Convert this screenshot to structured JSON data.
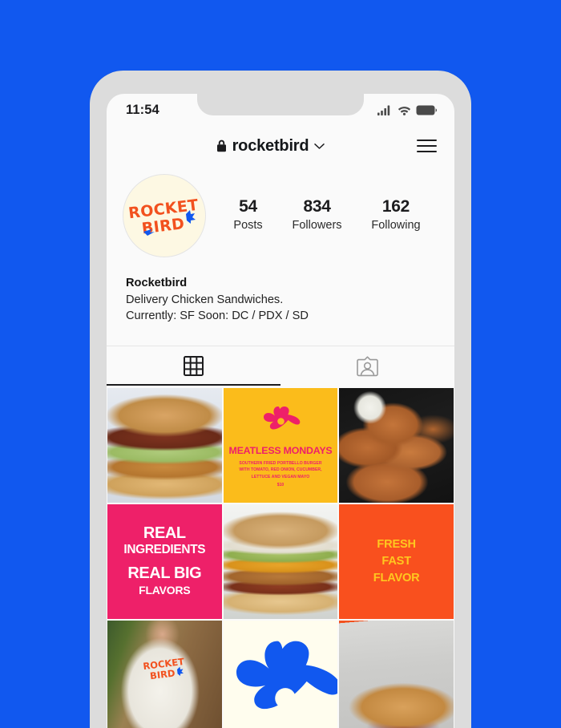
{
  "theme": {
    "page_background": "#1158EF",
    "phone_frame": "#dcdcdc",
    "screen_background": "#fafafa",
    "brand_blue": "#1158EF",
    "brand_red": "#F2511E",
    "brand_pink": "#EE2069",
    "brand_yellow": "#FBBC1B",
    "brand_orange": "#F9501E",
    "brand_cream": "#FFFDEE"
  },
  "status_bar": {
    "time": "11:54",
    "signal_icon": "cellular-signal-icon",
    "wifi_icon": "wifi-icon",
    "battery_icon": "battery-full-icon"
  },
  "header": {
    "lock_icon": "lock-icon",
    "username": "rocketbird",
    "chevron_icon": "chevron-down-icon",
    "menu_icon": "hamburger-menu-icon"
  },
  "profile": {
    "avatar_alt": "Rocket Bird logo",
    "logo_line1": "ROCKET",
    "logo_line2": "BIRD",
    "stats": [
      {
        "value": "54",
        "label": "Posts"
      },
      {
        "value": "834",
        "label": "Followers"
      },
      {
        "value": "162",
        "label": "Following"
      }
    ],
    "bio_name": "Rocketbird",
    "bio_line1": "Delivery Chicken Sandwiches.",
    "bio_line2": "Currently: SF  Soon: DC / PDX / SD"
  },
  "tabs": [
    {
      "name": "grid",
      "icon": "grid-icon",
      "active": true
    },
    {
      "name": "tagged",
      "icon": "tagged-person-icon",
      "active": false
    }
  ],
  "grid": {
    "tiles": [
      {
        "kind": "photo",
        "style": "photo-sandwich",
        "name": "post-chicken-sandwich-green-sauce",
        "alt": "Fried chicken sandwich with green sauce and lettuce"
      },
      {
        "kind": "text-yellow",
        "name": "post-meatless-mondays",
        "flower_icon": "pink-flower-icon",
        "title": "MEATLESS MONDAYS",
        "sub_line1": "SOUTHERN FRIED PORTBELLO BURGER",
        "sub_line2": "WITH TOMATO, RED ONION, CUCUMBER,",
        "sub_line3": "LETTUCE AND VEGAN MAYO",
        "price": "$10"
      },
      {
        "kind": "photo",
        "style": "photo-chicken",
        "name": "post-fried-chicken-tenders",
        "alt": "Fried chicken tenders with dipping sauce on dark tray"
      },
      {
        "kind": "text-pink",
        "name": "post-real-ingredients",
        "line1": "REAL",
        "line2": "INGREDIENTS",
        "line3": "REAL BIG",
        "line4": "FLAVORS"
      },
      {
        "kind": "photo",
        "style": "photo-cheeseburger",
        "name": "post-cheeseburger-pickles",
        "alt": "Chicken burger with cheddar, pickles and slaw"
      },
      {
        "kind": "text-orange",
        "name": "post-fresh-fast-flavor",
        "line1": "FRESH",
        "line2": "FAST",
        "line3": "FLAVOR"
      },
      {
        "kind": "photo",
        "style": "photo-tshirt",
        "name": "post-rocketbird-tshirt",
        "alt": "Person wearing white Rocket Bird t-shirt"
      },
      {
        "kind": "flower",
        "name": "post-blue-flower-graphic",
        "alt": "Blue abstract flower bird graphic on cream"
      },
      {
        "kind": "photo",
        "style": "photo-bun",
        "name": "post-sesame-bun-sandwich",
        "alt": "Sesame seed bun sandwich against concrete wall"
      }
    ]
  }
}
